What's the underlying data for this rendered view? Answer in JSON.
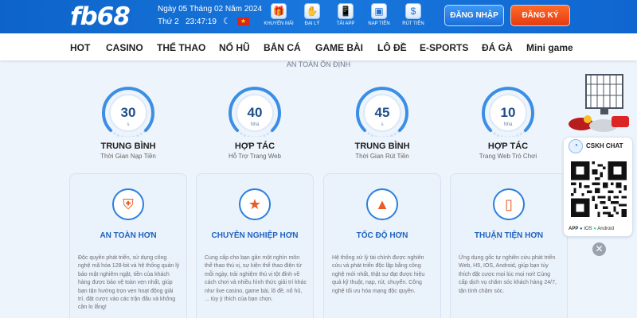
{
  "header": {
    "logo": "fb68",
    "date": "Ngày 05 Tháng 02 Năm 2024",
    "weekday": "Thứ 2",
    "time": "23:47:19",
    "flag_star": "★",
    "moon": "☾",
    "quick_links": [
      {
        "label": "KHUYẾN MÃI",
        "icon": "gift-icon",
        "glyph": "🎁"
      },
      {
        "label": "ĐẠI LÝ",
        "icon": "handshake-icon",
        "glyph": "✋"
      },
      {
        "label": "TẢI APP",
        "icon": "phone-icon",
        "glyph": "📱"
      },
      {
        "label": "NẠP TIỀN",
        "icon": "wallet-icon",
        "glyph": "▣"
      },
      {
        "label": "RÚT TIỀN",
        "icon": "money-bag-icon",
        "glyph": "$"
      }
    ],
    "login_label": "ĐĂNG NHẬP",
    "register_label": "ĐĂNG KÝ"
  },
  "nav": {
    "items": [
      "HOT",
      "CASINO",
      "THỂ THAO",
      "NỔ HŨ",
      "BẮN CÁ",
      "GAME BÀI",
      "LÔ ĐỀ",
      "E-SPORTS",
      "ĐÁ GÀ",
      "Mini game"
    ]
  },
  "tagline": "AN TOÀN ỔN ĐỊNH",
  "stats": [
    {
      "value": "30",
      "unit": "s",
      "title": "TRUNG BÌNH",
      "subtitle": "Thời Gian Nạp Tiền"
    },
    {
      "value": "40",
      "unit": "Nhà",
      "title": "HỢP TÁC",
      "subtitle": "Hỗ Trợ Trang Web"
    },
    {
      "value": "45",
      "unit": "s",
      "title": "TRUNG BÌNH",
      "subtitle": "Thời Gian Rút Tiền"
    },
    {
      "value": "10",
      "unit": "Nhà",
      "title": "HỢP TÁC",
      "subtitle": "Trang Web Trò Chơi"
    }
  ],
  "features": [
    {
      "title": "AN TOÀN HƠN",
      "icon": "shield-hands-icon",
      "glyph": "⛨",
      "text": "Độc quyền phát triển, sử dụng công nghệ mã hóa 128-bit và hệ thống quản lý bảo mật nghiêm ngặt, tiền của khách hàng được bảo vệ toàn vẹn nhất, giúp bạn tận hưởng trọn vẹn hoạt động giải trí, đặt cược vào các trận đấu và không cần lo lắng!"
    },
    {
      "title": "CHUYÊN NGHIỆP HƠN",
      "icon": "medal-icon",
      "glyph": "★",
      "text": "Cung cấp cho bạn gần một nghìn môn thể thao thú vị, sự kiện thể thao điện tử mỗi ngày, trải nghiệm thú vị tột đỉnh về cách chơi và nhiều hình thức giải trí khác như live casino, game bài, lô đề, nổ hũ, ... tùy ý thích của bạn chọn."
    },
    {
      "title": "TỐC ĐỘ HƠN",
      "icon": "rocket-icon",
      "glyph": "▲",
      "text": "Hệ thống xử lý tài chính được nghiên cứu và phát triển độc lập bằng công nghệ mới nhất, thật sự đạt được hiệu quả kỹ thuật, nạp, rút, chuyển. Công nghệ tối ưu hóa mạng độc quyền."
    },
    {
      "title": "THUẬN TIỆN HƠN",
      "icon": "mobile-app-icon",
      "glyph": "▯",
      "text": "Ứng dụng gốc tự nghiên cứu phát triển Web, H5, IOS, Android, giúp bạn tùy thích đặt cược mọi lúc mọi nơi! Cùng cấp dịch vụ chăm sóc khách hàng 24/7, tận tình chăm sóc."
    }
  ],
  "chat_widget": {
    "title": "CSKH CHAT",
    "app_label": "APP",
    "ios_label": "IOS",
    "android_label": "Android",
    "close_glyph": "✕",
    "bubble_glyph": "◔"
  },
  "colors": {
    "header_blue": "#1877dd",
    "login_blue": "#2f86ea",
    "register_orange": "#f0501c",
    "gauge_blue": "#3a8ee6"
  }
}
